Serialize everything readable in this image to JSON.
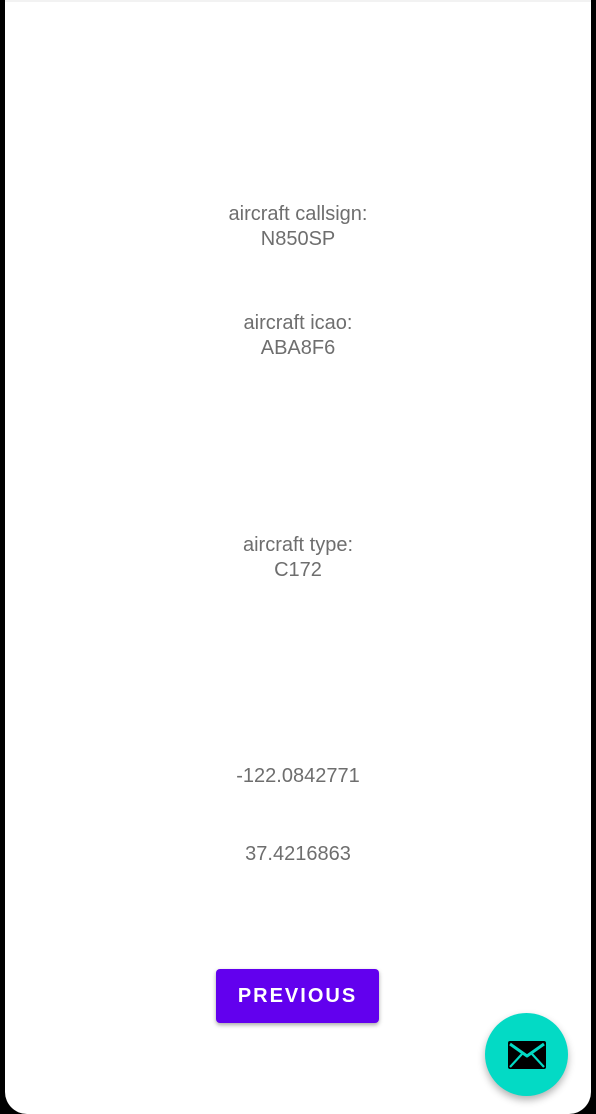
{
  "aircraft": {
    "callsign_label": "aircraft callsign:",
    "callsign_value": "N850SP",
    "icao_label": "aircraft icao:",
    "icao_value": "ABA8F6",
    "type_label": "aircraft type:",
    "type_value": "C172"
  },
  "position": {
    "longitude": "-122.0842771",
    "latitude": "37.4216863"
  },
  "actions": {
    "previous_label": "PREVIOUS"
  },
  "fab": {
    "icon": "email-icon"
  },
  "colors": {
    "primary_button": "#6200ee",
    "fab_background": "#03dac5",
    "text_secondary": "#6e6e6e"
  }
}
